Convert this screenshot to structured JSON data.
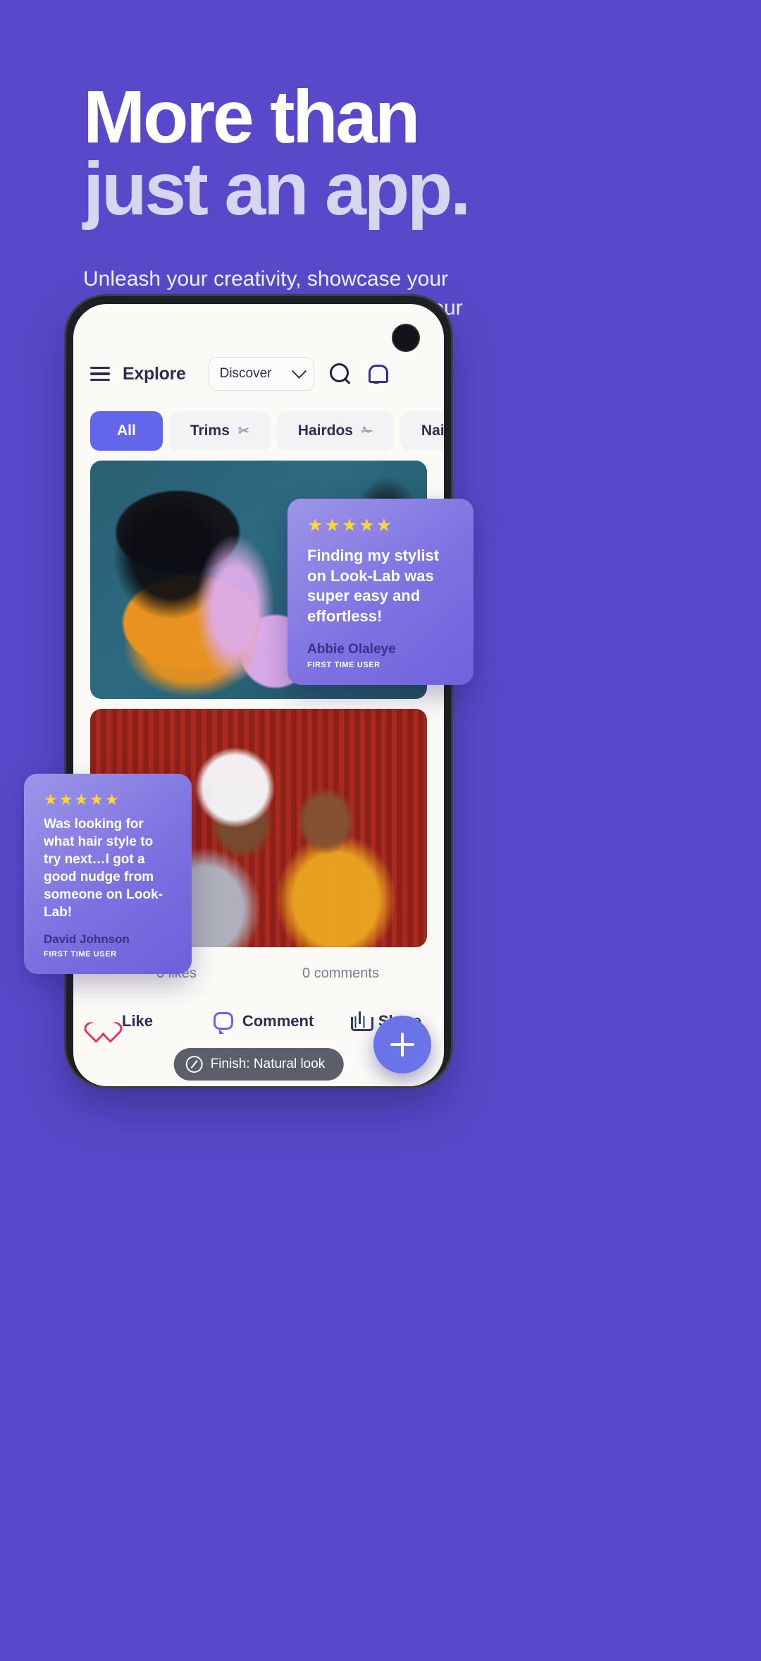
{
  "theme": {
    "background": "#5949ca",
    "accent": "#6366ea",
    "headline_primary_color": "#ffffff",
    "headline_secondary_color": "#d8d5ef",
    "star_color": "#ffd731",
    "like_color": "#ea2f5e"
  },
  "hero": {
    "headline_line1": "More than",
    "headline_line2": "just an app.",
    "subtitle": "Unleash your creativity, showcase your style journey in more detail and find your community."
  },
  "app": {
    "header": {
      "menu_icon": "hamburger-icon",
      "title": "Explore",
      "dropdown_value": "Discover",
      "dropdown_chevron": "chevron-down-icon",
      "search_icon": "search-icon",
      "notification_icon": "bell-icon"
    },
    "chips": [
      {
        "label": "All",
        "icon": "",
        "active": true
      },
      {
        "label": "Trims",
        "icon": "✂",
        "active": false
      },
      {
        "label": "Hairdos",
        "icon": "✁",
        "active": false
      },
      {
        "label": "Nails",
        "icon": "",
        "active": false
      }
    ],
    "posts": [
      {
        "alt": "braided-hair-styling-photo"
      },
      {
        "alt": "two-men-smiling-red-wall-photo"
      }
    ],
    "stats": {
      "likes": "0 likes",
      "comments": "0 comments"
    },
    "actions": [
      {
        "label": "Like",
        "icon": "heart-icon"
      },
      {
        "label": "Comment",
        "icon": "comment-icon"
      },
      {
        "label": "Share",
        "icon": "share-icon"
      }
    ],
    "finish_pill": {
      "icon": "edit-pencil-icon",
      "label": "Finish: Natural look"
    },
    "fab": {
      "icon": "plus-icon",
      "label": "+"
    }
  },
  "testimonials": [
    {
      "stars": "★★★★★",
      "quote": "Finding my stylist on Look-Lab was super easy and effortless!",
      "name": "Abbie Olaleye",
      "role": "FIRST TIME USER"
    },
    {
      "stars": "★★★★★",
      "quote": "Was looking for what hair style to try next…I got a good nudge from someone on Look-Lab!",
      "name": "David Johnson",
      "role": "FIRST TIME USER"
    }
  ]
}
